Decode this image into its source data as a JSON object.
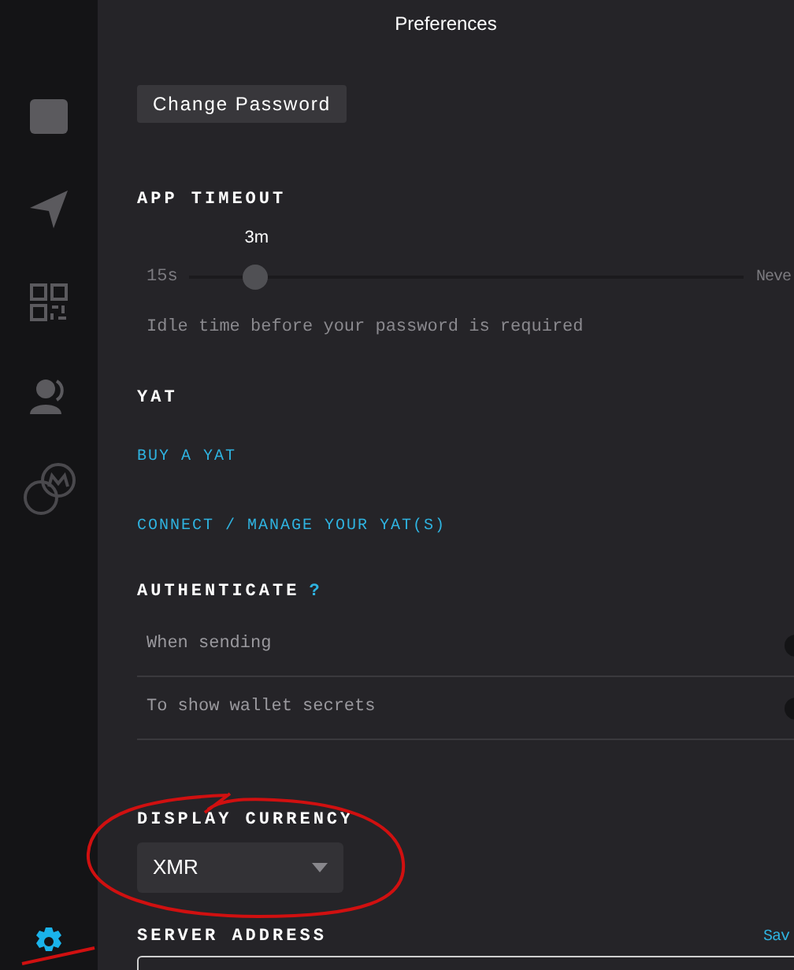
{
  "sidebar": {
    "items": [
      {
        "kind": "wallet",
        "selected": false
      },
      {
        "kind": "send",
        "selected": false
      },
      {
        "kind": "qr",
        "selected": false
      },
      {
        "kind": "contacts",
        "selected": false
      },
      {
        "kind": "coins",
        "selected": false
      },
      {
        "kind": "settings",
        "selected": true
      }
    ]
  },
  "title": "Preferences",
  "change_password": "Change Password",
  "app_timeout": {
    "heading": "APP TIMEOUT",
    "value": "3m",
    "min": "15s",
    "max": "Neve",
    "level": 0.12,
    "hint": "Idle time before your password is required"
  },
  "yat": {
    "heading": "YAT",
    "links": [
      "BUY A YAT",
      "CONNECT / MANAGE YOUR YAT(S)"
    ]
  },
  "authenticate": {
    "heading": "AUTHENTICATE",
    "help": "?",
    "options": [
      {
        "label": "When sending",
        "on": false
      },
      {
        "label": "To show wallet secrets",
        "on": false
      }
    ]
  },
  "display_currency": {
    "heading": "DISPLAY CURRENCY",
    "value": "XMR"
  },
  "server_address": {
    "heading": "SERVER ADDRESS",
    "action": "Sav"
  }
}
